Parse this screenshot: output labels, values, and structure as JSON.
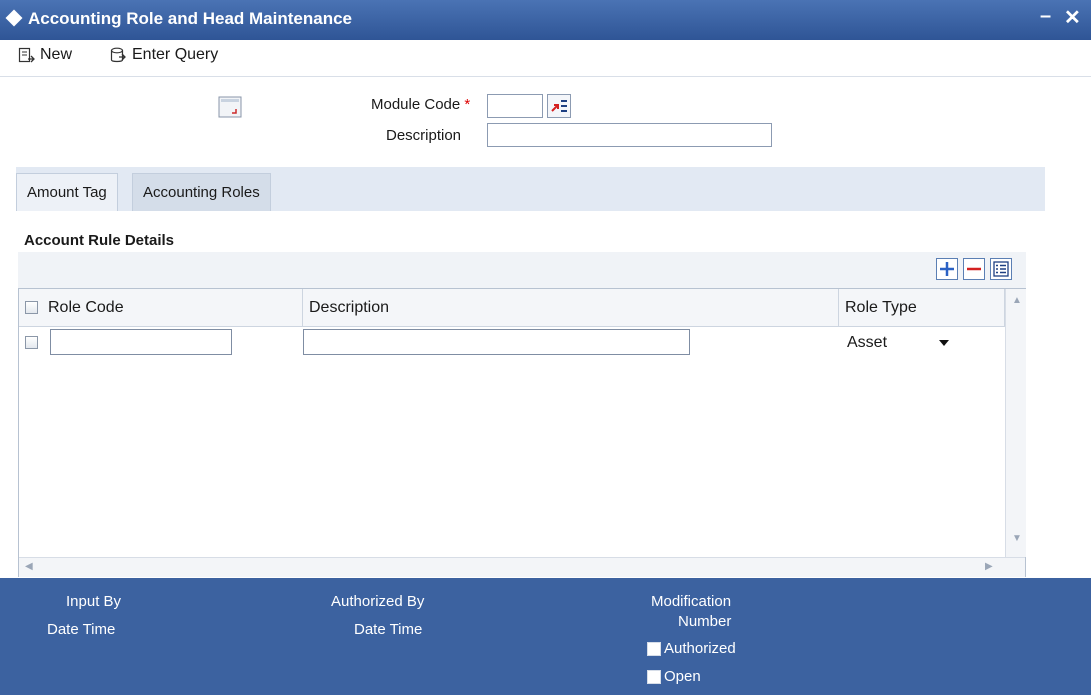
{
  "window": {
    "title": "Accounting Role and Head Maintenance",
    "minimize_glyph": "–",
    "close_glyph": "✕"
  },
  "toolbar": {
    "new_label": "New",
    "enter_query_label": "Enter Query"
  },
  "header_form": {
    "module_code_label": "Module Code",
    "required_marker": "*",
    "module_code_value": "",
    "description_label": "Description",
    "description_value": ""
  },
  "tabs": [
    {
      "label": "Amount Tag",
      "active": false
    },
    {
      "label": "Accounting Roles",
      "active": true
    }
  ],
  "section": {
    "title": "Account Rule Details"
  },
  "grid": {
    "columns": [
      "Role Code",
      "Description",
      "Role Type"
    ],
    "rows": [
      {
        "role_code": "",
        "description": "",
        "role_type": "Asset"
      }
    ]
  },
  "footer": {
    "input_by_label": "Input By",
    "date_time_label_1": "Date Time",
    "authorized_by_label": "Authorized By",
    "date_time_label_2": "Date Time",
    "modification_label": "Modification",
    "number_label": "Number",
    "authorized_label": "Authorized",
    "open_label": "Open"
  },
  "colors": {
    "title_bar": "#2f5596",
    "footer": "#3c62a0",
    "tab_strip": "#e2e9f3",
    "required": "#dd0000"
  }
}
